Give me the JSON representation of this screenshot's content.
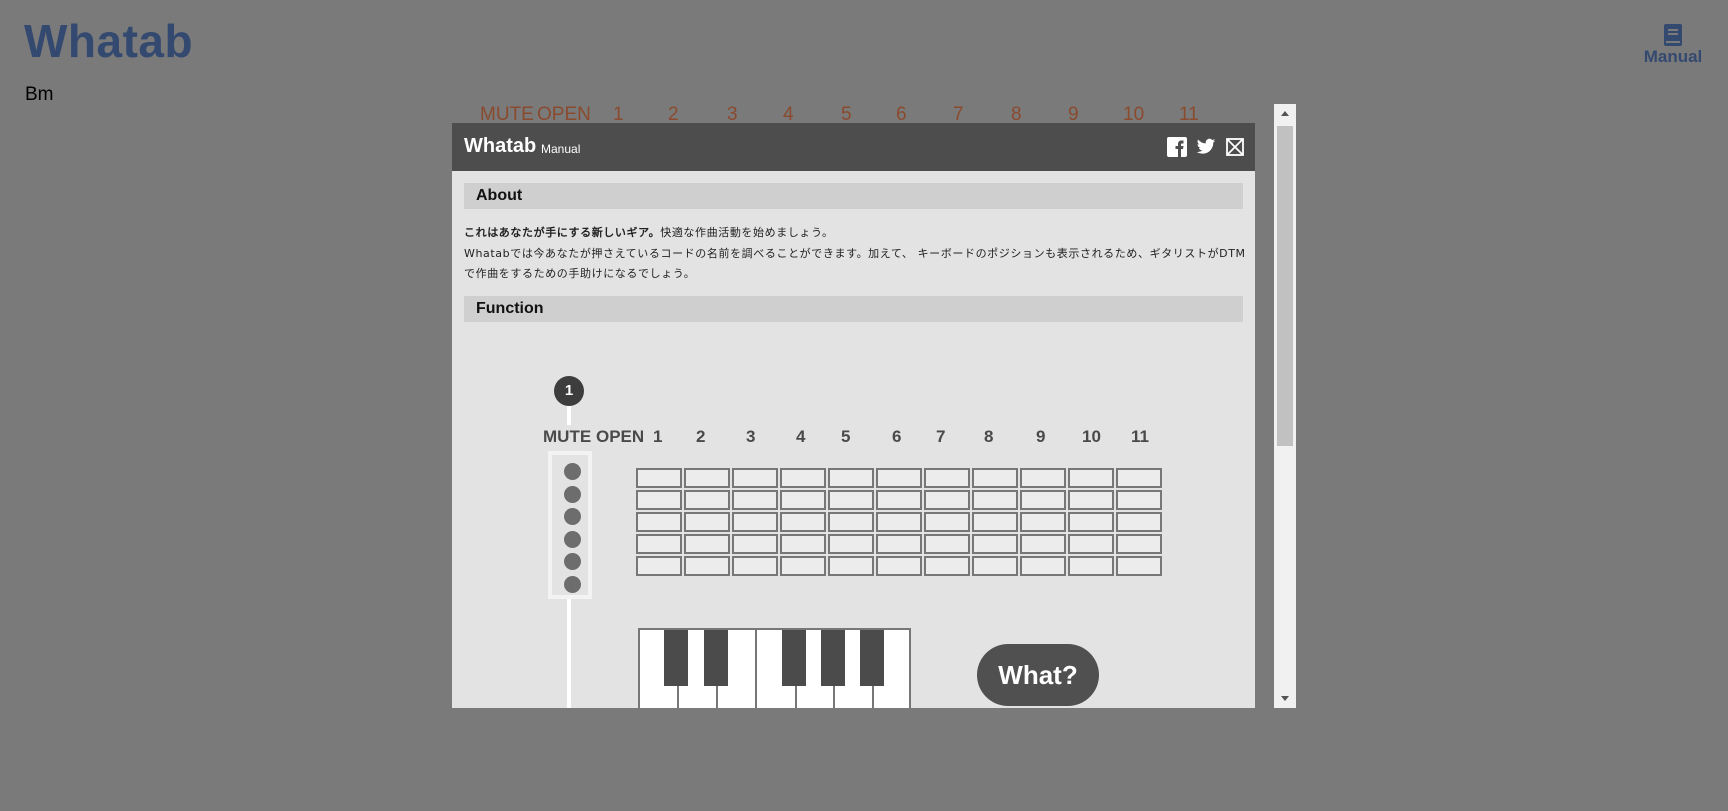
{
  "app": {
    "title": "Whatab",
    "chord": "Bm",
    "manual_label": "Manual",
    "accent_color": "#34496f"
  },
  "background_fret_header": {
    "labels": [
      "MUTE",
      "OPEN",
      "1",
      "2",
      "3",
      "4",
      "5",
      "6",
      "7",
      "8",
      "9",
      "10",
      "11"
    ],
    "color": "#8a4a2e"
  },
  "modal": {
    "title": "Whatab",
    "subtitle": "Manual",
    "icons": [
      "facebook-icon",
      "twitter-icon",
      "close-icon"
    ],
    "about": {
      "heading": "About",
      "lead_bold": "これはあなたが手にする新しいギア。",
      "lead_rest": "快適な作曲活動を始めましょう。",
      "body": "Whatabでは今あなたが押さえているコードの名前を調べることができます。加えて、 キーボードのポジションも表示されるため、ギタリストがDTMで作曲をするための手助けになるでしょう。"
    },
    "function": {
      "heading": "Function",
      "step_number": "1",
      "fret_labels": [
        "MUTE",
        "OPEN",
        "1",
        "2",
        "3",
        "4",
        "5",
        "6",
        "7",
        "8",
        "9",
        "10",
        "11"
      ],
      "strings": 6,
      "grid_rows": 5,
      "grid_columns": 11,
      "what_button": "What?"
    }
  },
  "scrollbar": {
    "up_arrow": "▲",
    "down_arrow": "▼"
  }
}
